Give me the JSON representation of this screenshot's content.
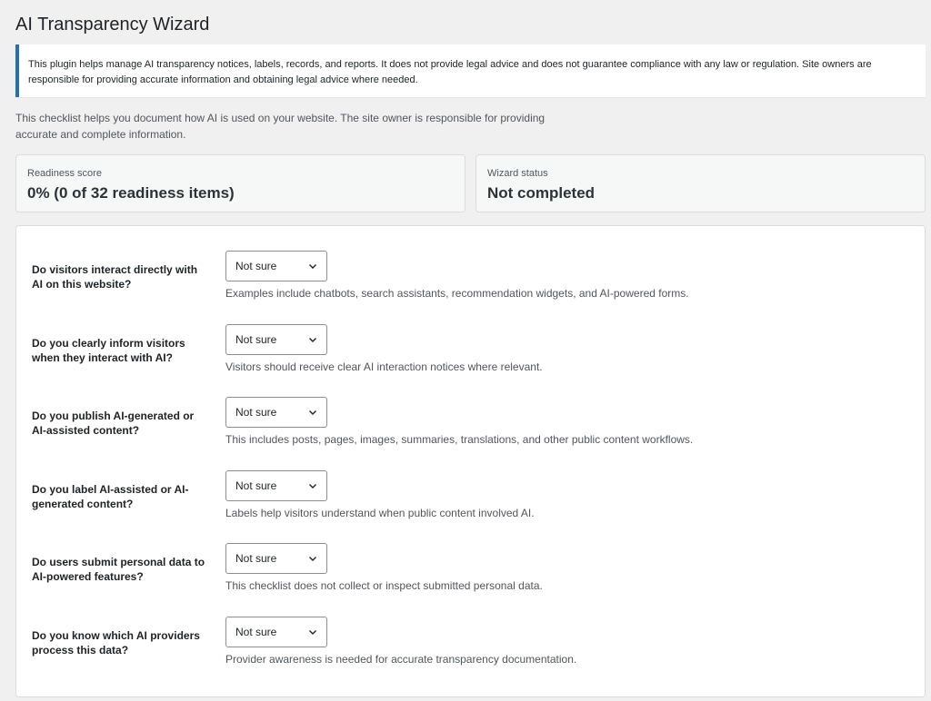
{
  "page": {
    "title": "AI Transparency Wizard"
  },
  "notice": {
    "text": "This plugin helps manage AI transparency notices, labels, records, and reports. It does not provide legal advice and does not guarantee compliance with any law or regulation. Site owners are responsible for providing accurate information and obtaining legal advice where needed."
  },
  "intro": {
    "text": "This checklist helps you document how AI is used on your website. The site owner is responsible for providing accurate and complete information."
  },
  "cards": {
    "readiness": {
      "label": "Readiness score",
      "value": "0% (0 of 32 readiness items)"
    },
    "status": {
      "label": "Wizard status",
      "value": "Not completed"
    }
  },
  "questions": [
    {
      "label": "Do visitors interact directly with AI on this website?",
      "selected": "Not sure",
      "help": "Examples include chatbots, search assistants, recommendation widgets, and AI-powered forms."
    },
    {
      "label": "Do you clearly inform visitors when they interact with AI?",
      "selected": "Not sure",
      "help": "Visitors should receive clear AI interaction notices where relevant."
    },
    {
      "label": "Do you publish AI-generated or AI-assisted content?",
      "selected": "Not sure",
      "help": "This includes posts, pages, images, summaries, translations, and other public content workflows."
    },
    {
      "label": "Do you label AI-assisted or AI-generated content?",
      "selected": "Not sure",
      "help": "Labels help visitors understand when public content involved AI."
    },
    {
      "label": "Do users submit personal data to AI-powered features?",
      "selected": "Not sure",
      "help": "This checklist does not collect or inspect submitted personal data."
    },
    {
      "label": "Do you know which AI providers process this data?",
      "selected": "Not sure",
      "help": "Provider awareness is needed for accurate transparency documentation."
    }
  ],
  "icons": {
    "select_arrow": "chevron-down-icon"
  },
  "colors": {
    "notice_border": "#2271b1",
    "background": "#f0f0f1"
  }
}
